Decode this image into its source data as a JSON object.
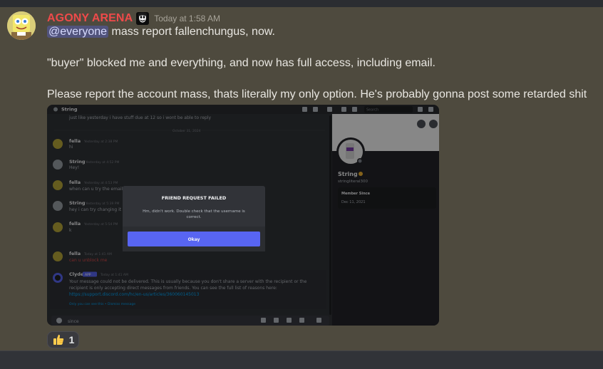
{
  "message": {
    "author": "AGONY ARENA",
    "timestamp": "Today at 1:58 AM",
    "mention": "@everyone",
    "line1_rest": " mass report fallenchungus, now.",
    "line2": "\"buyer\" blocked me and everything, and now has full access, including email.",
    "line3": "Please report the account mass, thats literally my only option. He's probably gonna post some retarded shit",
    "colors": {
      "author": "#ee4a4a",
      "mention_bg": "#5865f2",
      "background": "#4e4a3e"
    }
  },
  "reaction": {
    "emoji": "thumbs-up",
    "count": "1"
  },
  "embed": {
    "channel_name": "String",
    "search_placeholder": "Search",
    "first_line": "just like yesterday i have stuff due at 12 so i wont be able to reply",
    "date_divider": "October 31, 2024",
    "messages": [
      {
        "author": "fella",
        "time": "Yesterday at 2:38 PM",
        "text": "hi"
      },
      {
        "author": "String",
        "time": "Yesterday at 4:52 PM",
        "text": "Hey!"
      },
      {
        "author": "fella",
        "time": "Yesterday at 4:53 PM",
        "text": "when can u try the email"
      },
      {
        "author": "String",
        "time": "Yesterday at 5:39 PM",
        "text": "hey i can try changing it"
      },
      {
        "author": "fella",
        "time": "Yesterday at 5:54 PM",
        "text": "k"
      },
      {
        "author": "fella",
        "time": "Today at 1:41 AM",
        "text": "can u unblock me"
      }
    ],
    "clyde": {
      "author": "Clyde",
      "badge": "APP",
      "time": "Today at 1:41 AM",
      "text1": "Your message could not be delivered. This is usually because you don't share a server with the recipient or the",
      "text2": "recipient is only accepting direct messages from friends. You can see the full list of reasons here:",
      "link": "https://support.discord.com/hc/en-us/articles/360060145013",
      "footer": "Only you can see this • Dismiss message"
    },
    "input_text": "since",
    "modal": {
      "title": "FRIEND REQUEST FAILED",
      "body1": "Hm, didn't work. Double check that the username is",
      "body2": "correct.",
      "button": "Okay",
      "button_color": "#5865f2"
    },
    "profile": {
      "name": "String",
      "username": "stringliteral300",
      "member_since_label": "Member Since",
      "member_since": "Dec 11, 2021"
    }
  }
}
